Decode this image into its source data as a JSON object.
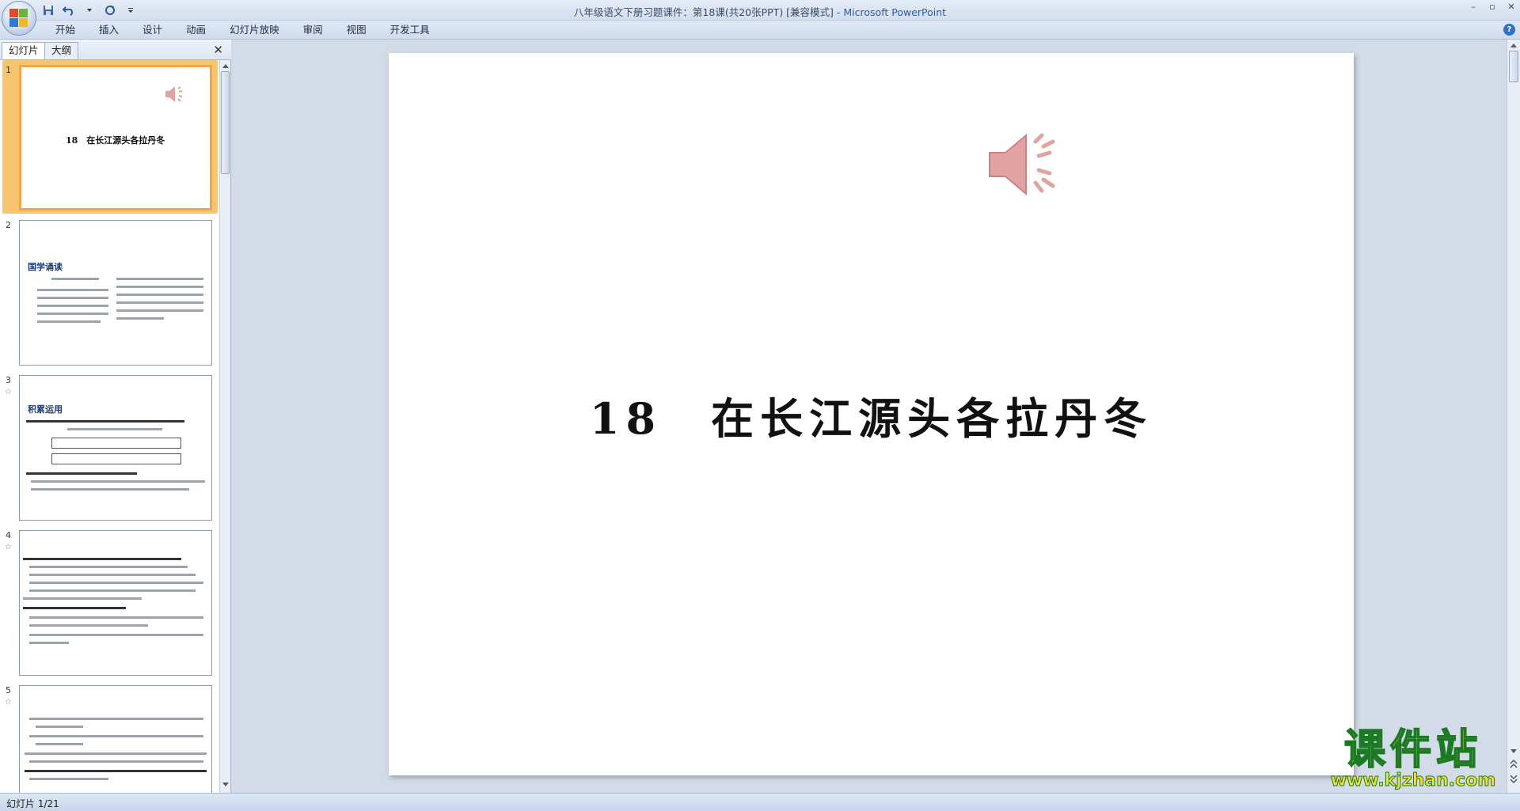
{
  "window": {
    "title": "八年级语文下册习题课件：第18课(共20张PPT) [兼容模式] - ",
    "app_name": "Microsoft PowerPoint",
    "minimize": "–",
    "restore": "▫",
    "close": "✕"
  },
  "ribbon": {
    "tabs": [
      "开始",
      "插入",
      "设计",
      "动画",
      "幻灯片放映",
      "审阅",
      "视图",
      "开发工具"
    ],
    "help": "?"
  },
  "left_pane": {
    "tab_slides": "幻灯片",
    "tab_outline": "大纲",
    "close": "✕",
    "slides": [
      {
        "number": "1",
        "title": "18　在长江源头各拉丹冬"
      },
      {
        "number": "2",
        "heading": "国学诵读"
      },
      {
        "number": "3",
        "heading": "积累运用"
      },
      {
        "number": "4"
      },
      {
        "number": "5"
      }
    ]
  },
  "slide": {
    "title": "18　在长江源头各拉丹冬"
  },
  "status": {
    "slide_counter": "幻灯片 1/21"
  },
  "watermark": {
    "main": "课件站",
    "url": "www.kjzhan.com"
  },
  "colors": {
    "selection": "#f1a64a",
    "speaker": "#e3a2a2",
    "watermark_fill": "#f6e12e",
    "watermark_stroke": "#1d7a24"
  }
}
